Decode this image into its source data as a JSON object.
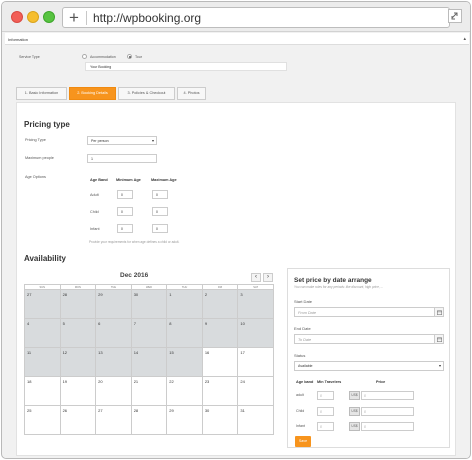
{
  "browser": {
    "url": "http://wpbooking.org"
  },
  "info_header": {
    "title": "Information"
  },
  "service_type": {
    "label": "Service Type",
    "options": [
      "Accommodation",
      "Tour"
    ],
    "selected": "Tour",
    "tour_name": "Your Booking"
  },
  "tabs": [
    {
      "label": "1. Basic Information"
    },
    {
      "label": "2. Booking Details"
    },
    {
      "label": "3. Policies & Checkout"
    },
    {
      "label": "4. Photos"
    }
  ],
  "active_tab": 1,
  "pricing": {
    "heading": "Pricing type",
    "pricing_type_label": "Pricing Type",
    "pricing_type_value": "Per person",
    "max_people_label": "Maximum people",
    "max_people_value": "1",
    "age_options_label": "Age Options",
    "age_headers": [
      "Age Band",
      "Minimum Age",
      "Maximum Age"
    ],
    "age_rows": [
      {
        "band": "Adult",
        "min": "0",
        "max": "0"
      },
      {
        "band": "Child",
        "min": "0",
        "max": "0"
      },
      {
        "band": "Infant",
        "min": "0",
        "max": "0"
      }
    ],
    "hint": "Provide your requirements for when age defines a child or adult."
  },
  "availability": {
    "heading": "Availability",
    "month": "Dec 2016",
    "prev": "‹",
    "next": "›",
    "weekdays": [
      "SUN",
      "MON",
      "TUE",
      "WED",
      "THU",
      "FRI",
      "SAT"
    ],
    "weeks": [
      [
        {
          "d": "27",
          "g": true
        },
        {
          "d": "28",
          "g": true
        },
        {
          "d": "29",
          "g": true
        },
        {
          "d": "30",
          "g": true
        },
        {
          "d": "1",
          "g": true
        },
        {
          "d": "2",
          "g": true
        },
        {
          "d": "3",
          "g": true
        }
      ],
      [
        {
          "d": "4",
          "g": true
        },
        {
          "d": "5",
          "g": true
        },
        {
          "d": "6",
          "g": true
        },
        {
          "d": "7",
          "g": true
        },
        {
          "d": "8",
          "g": true
        },
        {
          "d": "9",
          "g": true
        },
        {
          "d": "10",
          "g": true
        }
      ],
      [
        {
          "d": "11",
          "g": true
        },
        {
          "d": "12",
          "g": true
        },
        {
          "d": "13",
          "g": true
        },
        {
          "d": "14",
          "g": true
        },
        {
          "d": "15",
          "g": true
        },
        {
          "d": "16",
          "g": false
        },
        {
          "d": "17",
          "g": false
        }
      ],
      [
        {
          "d": "18",
          "g": false
        },
        {
          "d": "19",
          "g": false
        },
        {
          "d": "20",
          "g": false
        },
        {
          "d": "21",
          "g": false
        },
        {
          "d": "22",
          "g": false
        },
        {
          "d": "23",
          "g": false
        },
        {
          "d": "24",
          "g": false
        }
      ],
      [
        {
          "d": "25",
          "g": false
        },
        {
          "d": "26",
          "g": false
        },
        {
          "d": "27",
          "g": false
        },
        {
          "d": "28",
          "g": false
        },
        {
          "d": "29",
          "g": false
        },
        {
          "d": "30",
          "g": false
        },
        {
          "d": "31",
          "g": false
        }
      ]
    ]
  },
  "date_range": {
    "title": "Set price by date arrange",
    "subtitle": "You can make rules for any periods: like discount, high price, ...",
    "start_label": "Start Date",
    "start_placeholder": "From Date",
    "end_label": "End Date",
    "end_placeholder": "To Date",
    "status_label": "Status",
    "status_value": "Available",
    "headers": [
      "Age band",
      "Min Travelers",
      "Price"
    ],
    "rows": [
      {
        "band": "adult",
        "min": "0",
        "currency": "US$",
        "price": "0"
      },
      {
        "band": "Child",
        "min": "0",
        "currency": "US$",
        "price": "0"
      },
      {
        "band": "Infant",
        "min": "0",
        "currency": "US$",
        "price": "0"
      }
    ],
    "save_label": "Save"
  },
  "colors": {
    "accent": "#f7941d",
    "unavailable": "#d8dbdd"
  }
}
